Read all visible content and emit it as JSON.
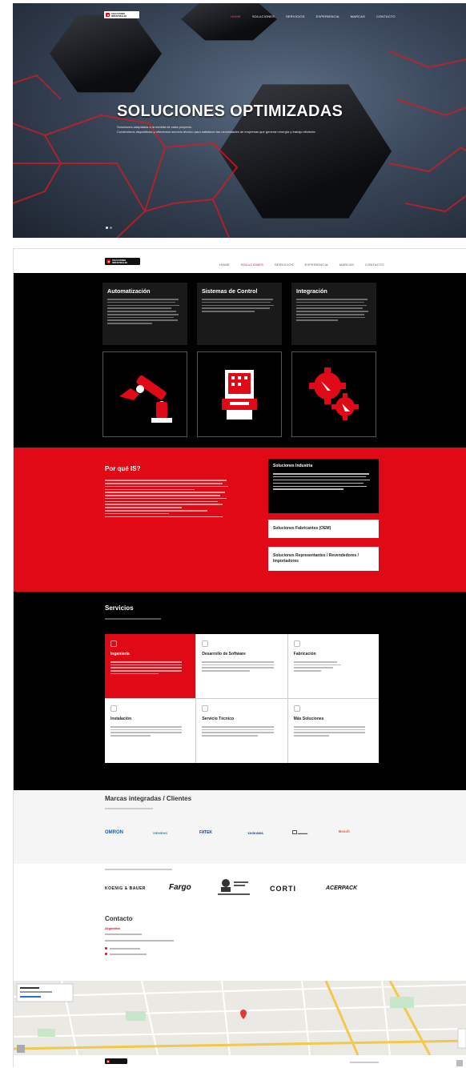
{
  "brand": {
    "logo_line1": "SOLUCIONES",
    "logo_line2": "INDUSTRIALES"
  },
  "nav": [
    "HOME",
    "SOLUCIONES",
    "SERVICIOS",
    "EXPERIENCIA",
    "MARCAS",
    "CONTACTO"
  ],
  "colors": {
    "accent": "#e00a16",
    "dark": "#000000",
    "nav_active": "#e00a16"
  },
  "hero": {
    "title": "SOLUCIONES OPTIMIZADAS",
    "sub1": "Soluciones adaptadas a la medida de cada proyecto.",
    "sub2": "Construimos dispositivos y ofrecemos servicio técnico para satisfacer las necesidades de empresas que generan energía y trabajo eficiente.",
    "slider_dots": 2
  },
  "soluciones": [
    {
      "title": "Automatización",
      "icon": "robot-arm-icon"
    },
    {
      "title": "Sistemas de Control",
      "icon": "control-panel-icon"
    },
    {
      "title": "Integración",
      "icon": "gears-icon"
    }
  ],
  "porque": {
    "title": "Por qué IS?",
    "industria_title": "Soluciones Industria",
    "btn_fabricantes": "Soluciones Fabricantes (OEM)",
    "btn_representantes": "Soluciones Representantes / Revendedores / Importadores"
  },
  "servicios": {
    "title": "Servicios",
    "items": [
      {
        "title": "Ingeniería",
        "icon": "pencil-icon"
      },
      {
        "title": "Desarrollo de Software",
        "icon": "monitor-icon"
      },
      {
        "title": "Fabricación",
        "icon": "tool-icon"
      },
      {
        "title": "Instalación",
        "icon": "plug-icon"
      },
      {
        "title": "Servicio Técnico",
        "icon": "wrench-icon"
      },
      {
        "title": "Más Soluciones",
        "icon": "bulb-icon"
      }
    ]
  },
  "marcas": {
    "title": "Marcas integradas / Clientes",
    "brands": [
      "OMRON",
      "SIEMENS",
      "FATEK",
      "YASKAWA",
      "",
      "Bosch"
    ],
    "clientes": [
      "KOENIG & BAUER",
      "Fargo",
      "",
      "CORTI",
      "ACERPACK"
    ]
  },
  "contacto": {
    "title": "Contacto",
    "country": "Argentina"
  }
}
